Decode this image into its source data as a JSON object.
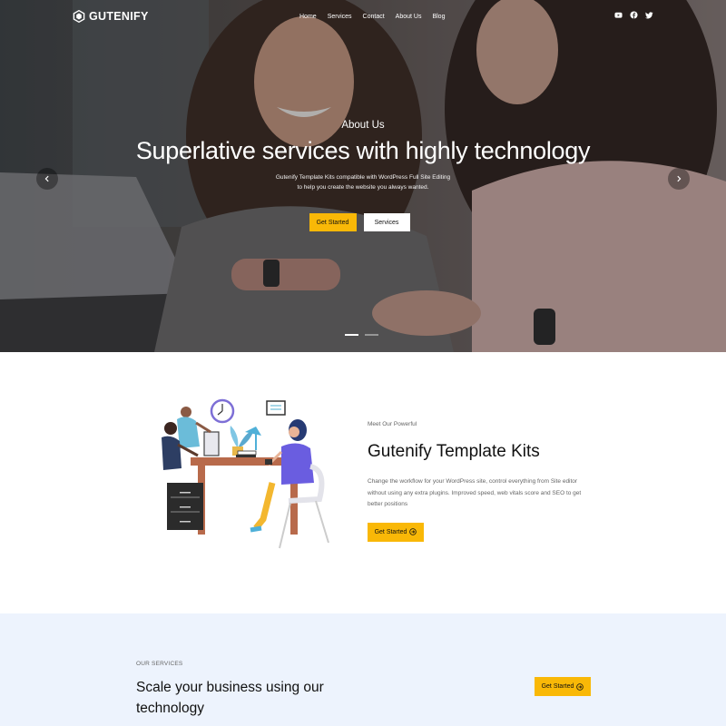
{
  "brand": {
    "name": "GUTENIFY",
    "accent": "#f9b807"
  },
  "nav": {
    "links": [
      "Home",
      "Services",
      "Contact",
      "About Us",
      "Blog"
    ],
    "socials": [
      "youtube-icon",
      "facebook-icon",
      "twitter-icon"
    ]
  },
  "hero": {
    "subtitle": "About Us",
    "title": "Superlative services with highly technology",
    "desc_line1": "Gutenify Template Kits compatible with WordPress Full Site Editing",
    "desc_line2": "to help you create the website you always wanted.",
    "primary_btn": "Get Started",
    "secondary_btn": "Services",
    "slides": 2,
    "active_slide": 1
  },
  "feature": {
    "kicker": "Meet Our Powerful",
    "title": "Gutenify Template Kits",
    "desc": "Change the workflow for your WordPress site, control everything from Site editor without using any extra plugins. Improved speed, web vitals score and SEO to get better positions",
    "btn": "Get Started"
  },
  "services": {
    "kicker": "OUR SERVICES",
    "title": "Scale your business using our technology",
    "btn": "Get Started",
    "bg": "#edf3fd"
  }
}
